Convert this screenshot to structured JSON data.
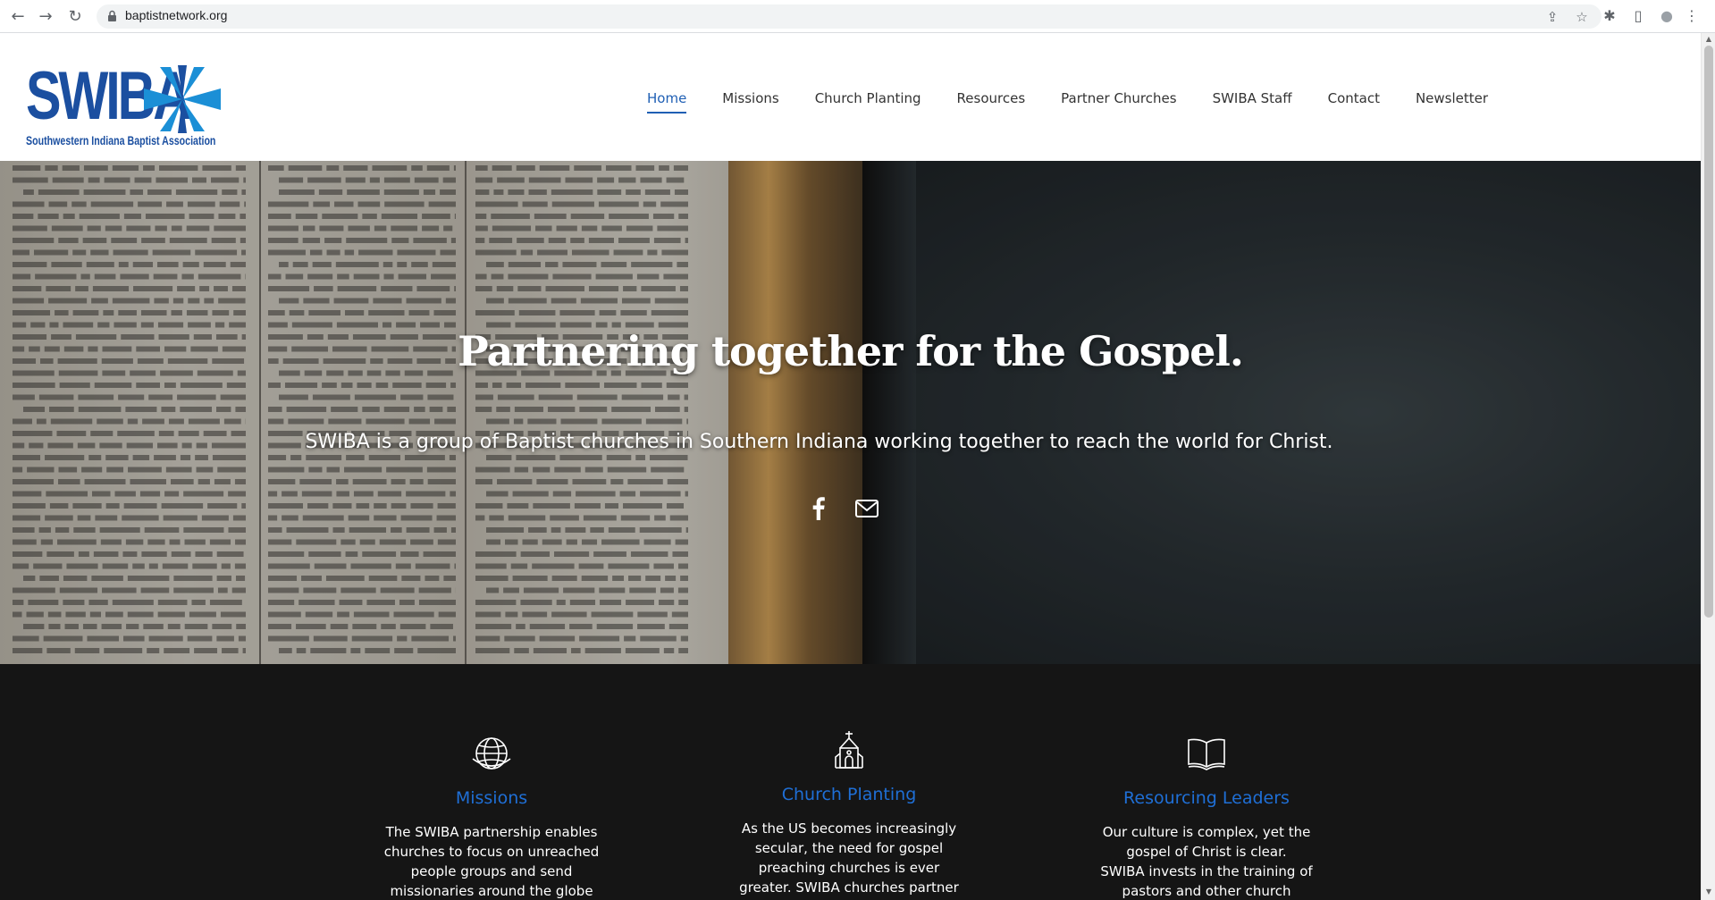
{
  "browser": {
    "url": "baptistnetwork.org",
    "back_icon": "←",
    "forward_icon": "→",
    "reload_icon": "↻",
    "share_icon": "⇪",
    "star_icon": "☆",
    "extensions_icon": "✱",
    "sidebar_icon": "▯",
    "profile_icon": "●",
    "menu_icon": "⋮"
  },
  "header": {
    "logo_word": "SWIBA",
    "logo_subtitle": "Southwestern Indiana Baptist Association",
    "nav": [
      "Home",
      "Missions",
      "Church Planting",
      "Resources",
      "Partner Churches",
      "SWIBA Staff",
      "Contact",
      "Newsletter"
    ],
    "active_nav": "Home"
  },
  "hero": {
    "title": "Partnering together for the Gospel.",
    "subtitle": "SWIBA is a group of Baptist churches in Southern Indiana working together to reach the world for Christ."
  },
  "features": [
    {
      "title": "Missions",
      "icon": "globe-icon",
      "lines": [
        "The SWIBA partnership enables",
        "churches to focus on unreached",
        "people groups and send",
        "missionaries around the globe"
      ]
    },
    {
      "title": "Church Planting",
      "icon": "church-icon",
      "lines": [
        "As the US becomes increasingly",
        "secular, the need for gospel",
        "preaching churches is ever",
        "greater.  SWIBA churches partner"
      ]
    },
    {
      "title": "Resourcing Leaders",
      "icon": "open-book-icon",
      "lines": [
        "Our culture is complex, yet the",
        "gospel of Christ is clear.",
        "SWIBA invests in the training of",
        "pastors and other church"
      ]
    }
  ],
  "colors": {
    "brand_blue": "#1b4fa0",
    "nav_active": "#1f5fb4",
    "feature_title": "#1f6fd6",
    "features_bg": "#151515"
  }
}
